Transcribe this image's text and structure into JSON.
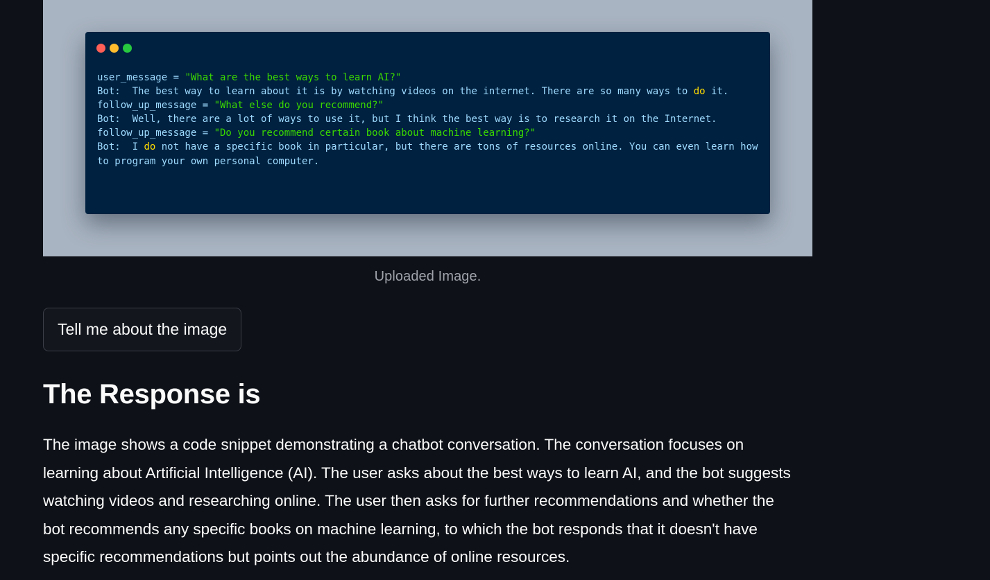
{
  "image": {
    "window_dots": [
      {
        "name": "close",
        "color": "#ff5f56"
      },
      {
        "name": "minimize",
        "color": "#ffbd2e"
      },
      {
        "name": "maximize",
        "color": "#27c93f"
      }
    ],
    "code": {
      "line1_var": "user_message = ",
      "line1_str": "\"What are the best ways to learn AI?\"",
      "line2_a": "Bot:  The best way to learn about it is by watching videos on the internet. There are so many ways to ",
      "line2_kw": "do",
      "line2_b": " it.",
      "line3_var": "follow_up_message = ",
      "line3_str": "\"What else do you recommend?\"",
      "line4": "Bot:  Well, there are a lot of ways to use it, but I think the best way is to research it on the Internet.",
      "line5_var": "follow_up_message = ",
      "line5_str": "\"Do you recommend certain book about machine learning?\"",
      "line6_a": "Bot:  I ",
      "line6_kw": "do",
      "line6_b": " not have a specific book in particular, but there are tons of resources online. You can even learn how to program your own personal computer."
    },
    "caption": "Uploaded Image."
  },
  "button": {
    "label": "Tell me about the image"
  },
  "heading": "The Response is",
  "response_text": "The image shows a code snippet demonstrating a chatbot conversation. The conversation focuses on learning about Artificial Intelligence (AI). The user asks about the best ways to learn AI, and the bot suggests watching videos and researching online. The user then asks for further recommendations and whether the bot recommends any specific books on machine learning, to which the bot responds that it doesn't have specific recommendations but points out the abundance of online resources."
}
